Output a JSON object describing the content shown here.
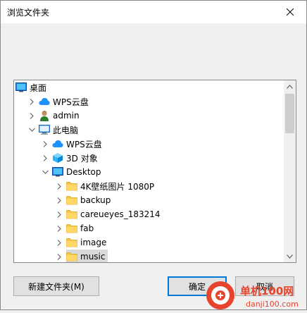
{
  "window": {
    "title": "浏览文件夹",
    "close_label": "✕"
  },
  "tree": {
    "items": [
      {
        "label": "桌面",
        "icon": "desktop-folder-icon",
        "level": 0,
        "arrow": "none"
      },
      {
        "label": "WPS云盘",
        "icon": "cloud-icon",
        "level": 1,
        "arrow": "right"
      },
      {
        "label": "admin",
        "icon": "user-icon",
        "level": 1,
        "arrow": "right"
      },
      {
        "label": "此电脑",
        "icon": "computer-icon",
        "level": 1,
        "arrow": "down"
      },
      {
        "label": "WPS云盘",
        "icon": "cloud-icon",
        "level": 2,
        "arrow": "right"
      },
      {
        "label": "3D 对象",
        "icon": "cube-icon",
        "level": 2,
        "arrow": "right"
      },
      {
        "label": "Desktop",
        "icon": "desktop-folder-icon",
        "level": 2,
        "arrow": "down"
      },
      {
        "label": "4K壁纸图片 1080P",
        "icon": "folder-icon",
        "level": 3,
        "arrow": "right"
      },
      {
        "label": "backup",
        "icon": "folder-icon",
        "level": 3,
        "arrow": "right"
      },
      {
        "label": "careueyes_183214",
        "icon": "folder-icon",
        "level": 3,
        "arrow": "right"
      },
      {
        "label": "fab",
        "icon": "folder-icon",
        "level": 3,
        "arrow": "right"
      },
      {
        "label": "image",
        "icon": "folder-icon",
        "level": 3,
        "arrow": "right"
      },
      {
        "label": "music",
        "icon": "folder-icon",
        "level": 3,
        "arrow": "right",
        "selected": true
      }
    ]
  },
  "buttons": {
    "new_folder": "新建文件夹(M)",
    "ok": "确定",
    "cancel": "取消"
  },
  "watermark": {
    "text": "单机100网",
    "url_text": "danji100.com"
  },
  "colors": {
    "accent": "#0078d7",
    "folder": "#f5c542",
    "cloud": "#1e90ff",
    "watermark_red": "#e8432d"
  }
}
